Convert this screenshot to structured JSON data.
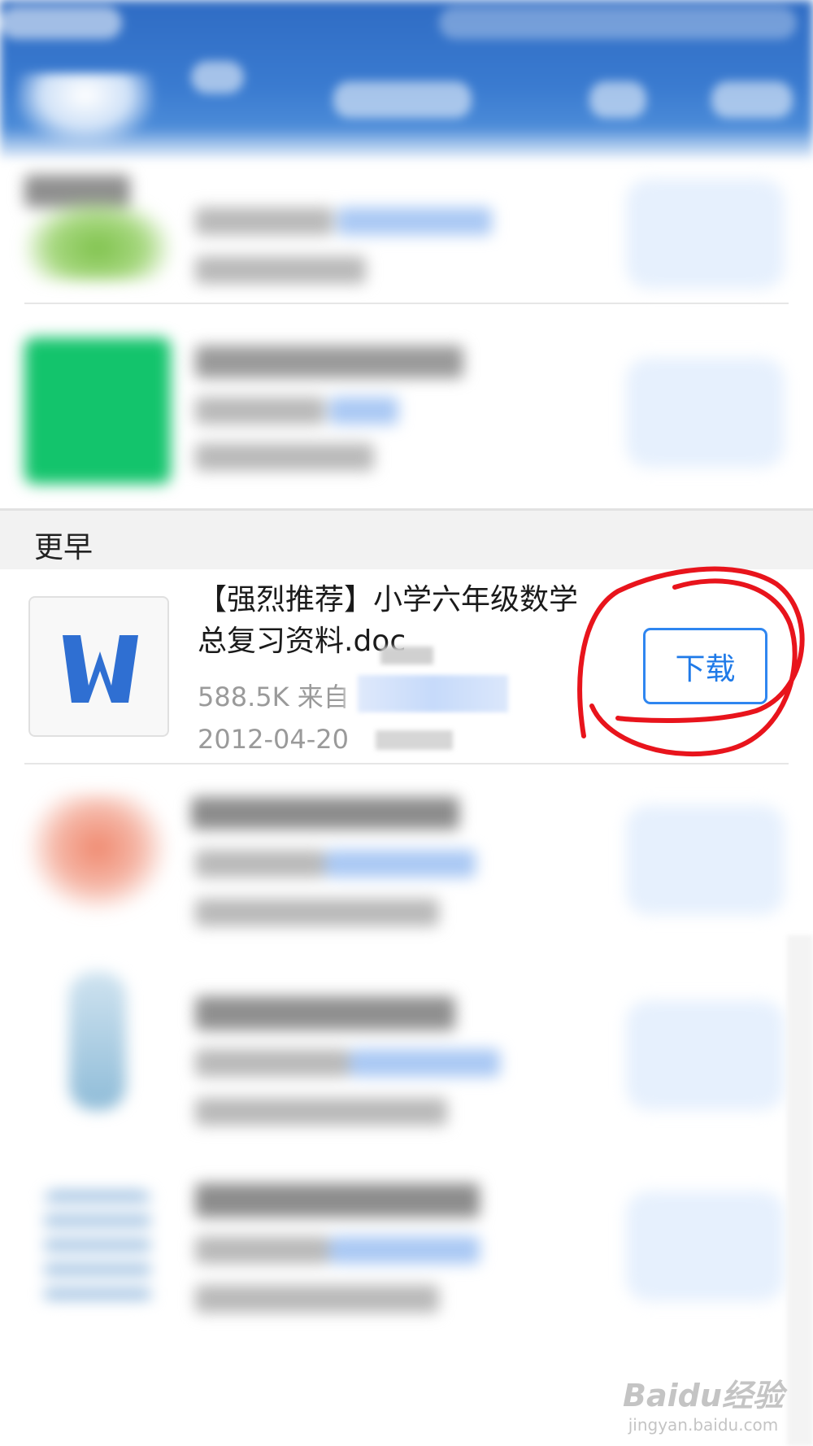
{
  "section": {
    "title": "更早"
  },
  "item": {
    "title_line1": "【强烈推荐】小学六年级数学",
    "title_line2": "总复习资料.doc",
    "size_from": "588.5K 来自",
    "date": "2012-04-20",
    "download_label": "下载",
    "icon": "word-document-icon"
  },
  "watermark": {
    "logo": "Baidu经验",
    "url": "jingyan.baidu.com"
  },
  "colors": {
    "header_blue": "#3a7bd0",
    "button_blue": "#2f86f0",
    "annotation_red": "#e8141c",
    "word_icon_blue": "#2f6fd2"
  }
}
